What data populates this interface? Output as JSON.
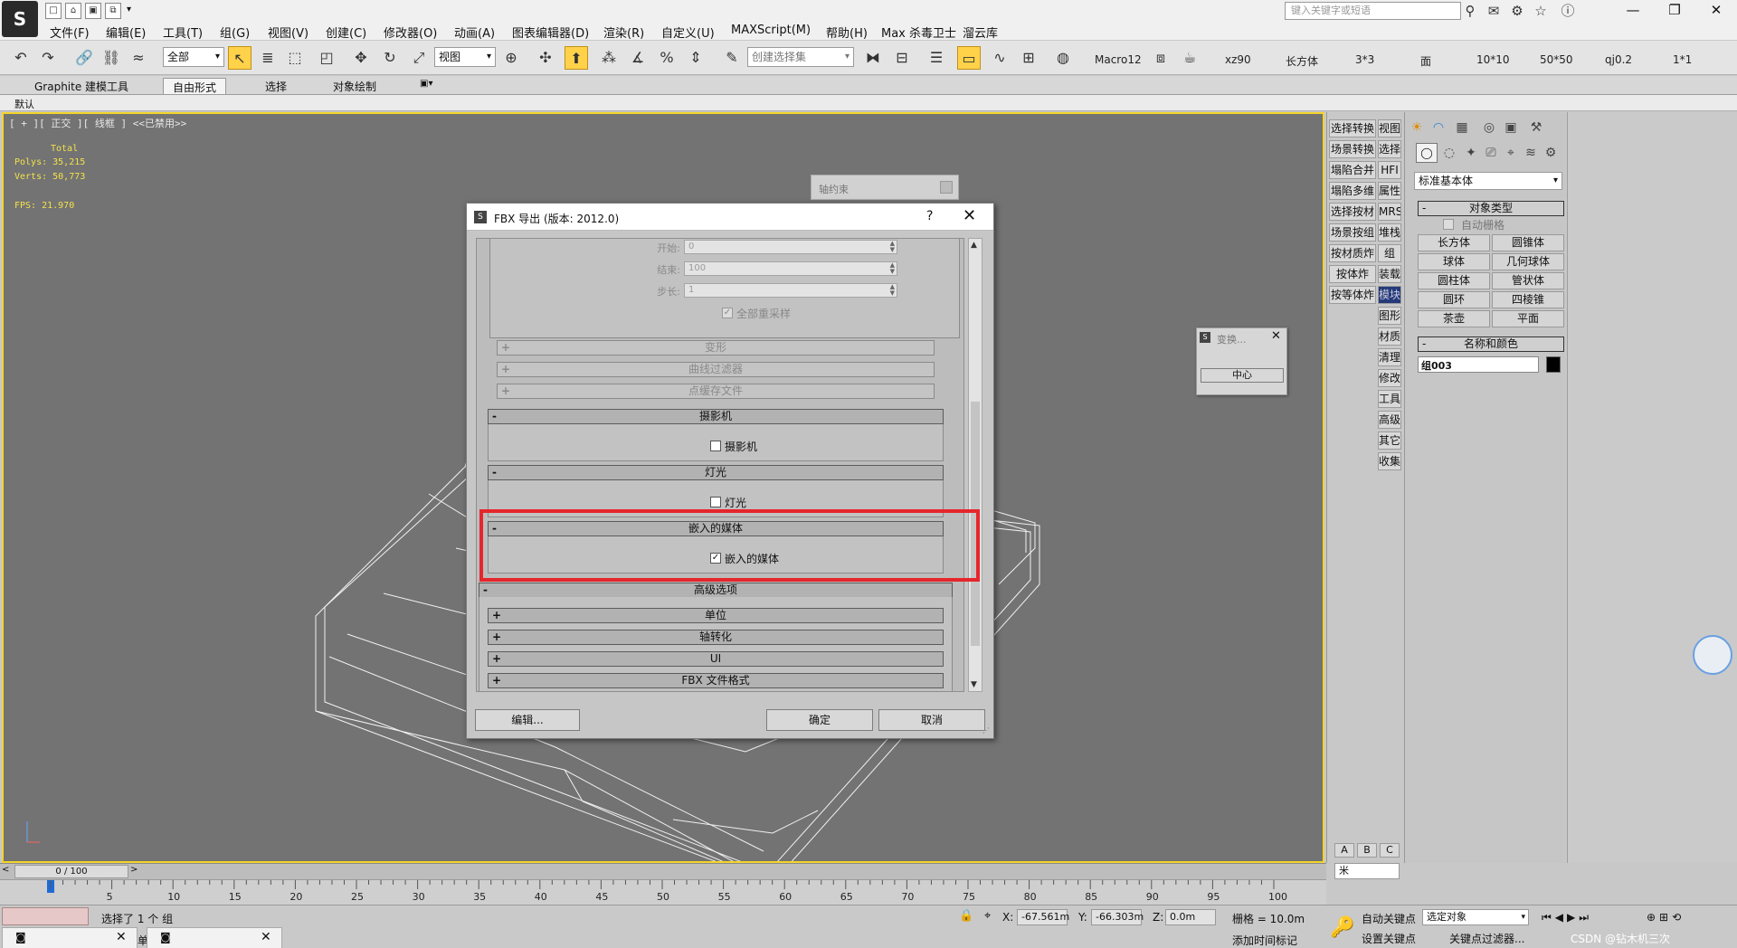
{
  "menu": [
    "文件(F)",
    "编辑(E)",
    "工具(T)",
    "组(G)",
    "视图(V)",
    "创建(C)",
    "修改器(O)",
    "动画(A)",
    "图表编辑器(D)",
    "渲染(R)",
    "自定义(U)",
    "MAXScript(M)",
    "帮助(H)",
    "Max 杀毒卫士",
    "溜云库"
  ],
  "search_placeholder": "键入关键字或短语",
  "toolbar": {
    "selection_filter": "全部",
    "ref_coord": "视图",
    "named_selection": "创建选择集",
    "scripts": [
      "Macro12",
      "xz90",
      "长方体",
      "3*3",
      "面",
      "10*10",
      "50*50",
      "qj0.2",
      "1*1"
    ]
  },
  "ribbon": {
    "tabs": [
      "Graphite 建模工具",
      "自由形式",
      "选择",
      "对象绘制"
    ],
    "sub": "默认"
  },
  "viewport": {
    "label": "[ + ][ 正交 ][ 线框 ] <<已禁用>>",
    "stats_title": "Total",
    "polys": "Polys: 35,215",
    "verts": "Verts: 50,773",
    "fps": "FPS:   21.970",
    "frame_counter": "0 / 100"
  },
  "axis_panel": {
    "title": "轴约束"
  },
  "transform_dialog": {
    "title": "变换...",
    "button": "中心"
  },
  "fbx": {
    "title": "FBX 导出 (版本: 2012.0)",
    "help": "?",
    "fields": [
      {
        "label": "开始:",
        "value": "0"
      },
      {
        "label": "结束:",
        "value": "100"
      },
      {
        "label": "步长:",
        "value": "1"
      }
    ],
    "resample_all": "全部重采样",
    "sub_rollouts": [
      "变形",
      "曲线过滤器",
      "点缓存文件"
    ],
    "camera": {
      "header": "摄影机",
      "checkbox": "摄影机"
    },
    "light": {
      "header": "灯光",
      "checkbox": "灯光"
    },
    "media": {
      "header": "嵌入的媒体",
      "checkbox": "嵌入的媒体"
    },
    "advanced": {
      "header": "高级选项",
      "items": [
        "单位",
        "轴转化",
        "UI",
        "FBX 文件格式"
      ]
    },
    "buttons": {
      "edit": "编辑...",
      "ok": "确定",
      "cancel": "取消"
    }
  },
  "side_buttons": [
    [
      "选择转换",
      "视图"
    ],
    [
      "场景转换",
      "选择"
    ],
    [
      "塌陷合并",
      "HFI"
    ],
    [
      "塌陷多维",
      "属性"
    ],
    [
      "选择按材",
      "MRS"
    ],
    [
      "场景按组",
      "堆栈"
    ],
    [
      "按材质炸",
      "组"
    ],
    [
      "按体炸",
      "装载"
    ],
    [
      "按等体炸",
      "模块"
    ],
    [
      "",
      "图形"
    ],
    [
      "",
      "材质"
    ],
    [
      "",
      "清理"
    ],
    [
      "",
      "修改"
    ],
    [
      "",
      "工具"
    ],
    [
      "",
      "高级"
    ],
    [
      "",
      "其它"
    ],
    [
      "",
      "收集"
    ]
  ],
  "cmd_panel": {
    "category": "标准基本体",
    "object_type": "对象类型",
    "autogrid": "自动栅格",
    "objects": [
      "长方体",
      "圆锥体",
      "球体",
      "几何球体",
      "圆柱体",
      "管状体",
      "圆环",
      "四棱锥",
      "茶壶",
      "平面"
    ],
    "name_color": "名称和颜色",
    "name_value": "组003",
    "abc": [
      "A",
      "B",
      "C"
    ],
    "unit": "米"
  },
  "timeline": {
    "ticks": [
      "5",
      "10",
      "15",
      "20",
      "25",
      "30",
      "35",
      "40",
      "45",
      "50",
      "55",
      "60",
      "65",
      "70",
      "75",
      "80",
      "85",
      "90",
      "95",
      "100"
    ]
  },
  "status": {
    "selection": "选择了 1 个 组",
    "click_hint": "单击",
    "x_label": "X:",
    "x": "-67.561m",
    "y_label": "Y:",
    "y": "-66.303m",
    "z_label": "Z:",
    "z": "0.0m",
    "grid": "栅格 = 10.0m",
    "auto_key": "自动关键点",
    "selected_objects": "选定对象",
    "set_key": "设置关键点",
    "key_filters": "关键点过滤器...",
    "add_time_tag": "添加时间标记",
    "watermark": "CSDN @钻木机三次"
  },
  "colors": {
    "viewport_bg": "#737373",
    "viewport_border": "#f3d52a",
    "highlight": "#e5262b",
    "stat_text": "#f4e14a"
  }
}
